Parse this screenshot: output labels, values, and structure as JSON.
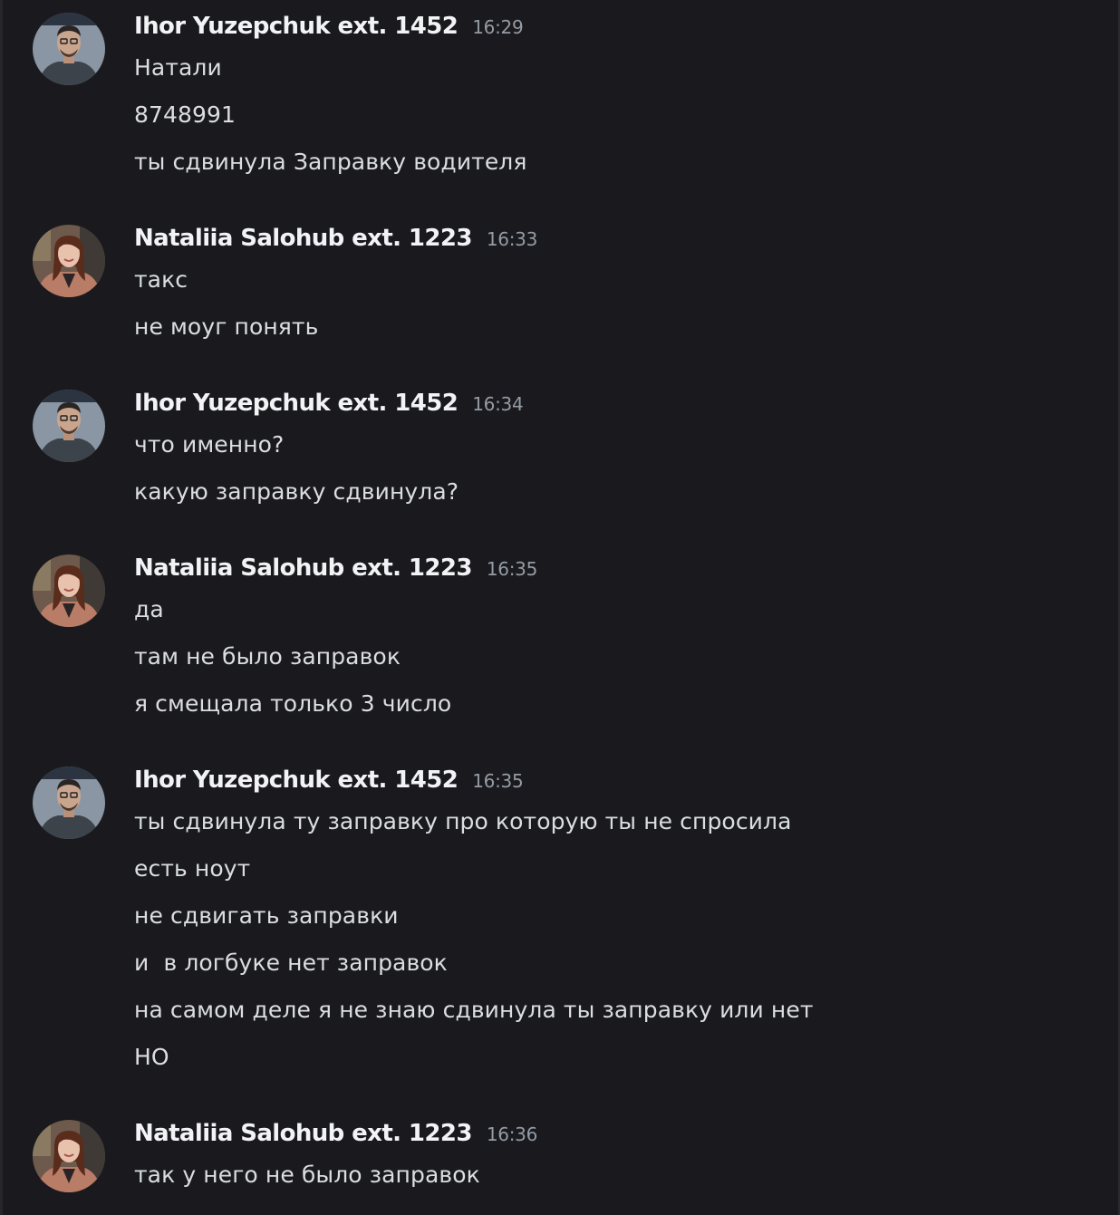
{
  "users": {
    "ihor": {
      "name": "Ihor Yuzepchuk ext. 1452",
      "avatar": "man-portrait-avatar",
      "avatar_bg": "#8a96a3",
      "shirt": "#3d434a",
      "skin": "#caa58e"
    },
    "nataliia": {
      "name": "Nataliia Salohub ext. 1223",
      "avatar": "woman-portrait-avatar",
      "avatar_bg": "#6e5a4c",
      "coat": "#b87c67",
      "hair": "#5a2c1c",
      "skin": "#e9c2ad"
    }
  },
  "colors": {
    "background": "#1a1a1e",
    "author": "#f2f3f5",
    "timestamp": "#949ba4",
    "message": "#dbdee1"
  },
  "messages": [
    {
      "author": "Ihor Yuzepchuk ext. 1452",
      "time": "16:29",
      "lines": [
        "Натали",
        "8748991",
        "ты сдвинула Заправку водителя"
      ]
    },
    {
      "author": "Nataliia Salohub ext. 1223",
      "time": "16:33",
      "lines": [
        "такс",
        "не моуг понять"
      ]
    },
    {
      "author": "Ihor Yuzepchuk ext. 1452",
      "time": "16:34",
      "lines": [
        "что именно?",
        "какую заправку сдвинула?"
      ]
    },
    {
      "author": "Nataliia Salohub ext. 1223",
      "time": "16:35",
      "lines": [
        "да",
        "там не было заправок",
        "я смещала только 3 число"
      ]
    },
    {
      "author": "Ihor Yuzepchuk ext. 1452",
      "time": "16:35",
      "lines": [
        "ты сдвинула ту заправку про которую ты не спросила",
        "есть ноут",
        "не сдвигать заправки",
        "и  в логбуке нет заправок",
        "на самом деле я не знаю сдвинула ты заправку или нет",
        "НО"
      ]
    },
    {
      "author": "Nataliia Salohub ext. 1223",
      "time": "16:36",
      "lines": [
        "так у него не было заправок"
      ]
    }
  ]
}
